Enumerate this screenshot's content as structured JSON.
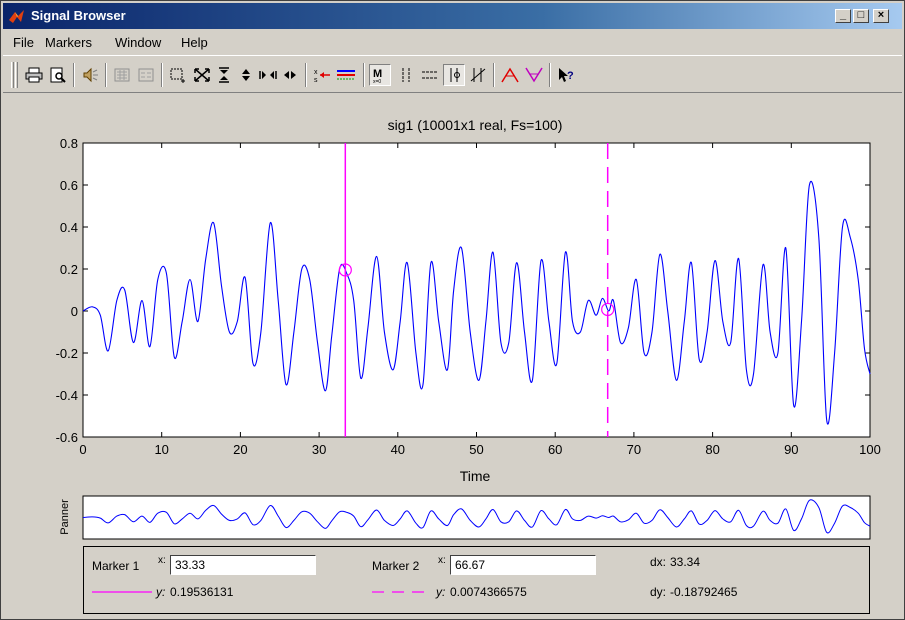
{
  "window": {
    "title": "Signal Browser"
  },
  "menu": [
    "File",
    "Markers",
    "Window",
    "Help"
  ],
  "toolbar": [
    "print",
    "print-preview",
    "play",
    "array-signal",
    "select-signals",
    "zoom-box",
    "zoom-full",
    "zoom-y-in",
    "zoom-y-out",
    "zoom-x-in",
    "zoom-x-out",
    "select-signal",
    "line-properties",
    "markers",
    "vertical-markers",
    "horizontal-markers",
    "track-markers",
    "slope-markers",
    "peaks",
    "valleys",
    "whats-this"
  ],
  "chart_data": {
    "type": "line",
    "title": "sig1 (10001x1 real, Fs=100)",
    "xlabel": "Time",
    "ylabel": "",
    "xlim": [
      0,
      100
    ],
    "ylim": [
      -0.6,
      0.8
    ],
    "xticks": [
      "0",
      "10",
      "20",
      "30",
      "40",
      "50",
      "60",
      "70",
      "80",
      "90",
      "100"
    ],
    "yticks": [
      "0.8",
      "0.6",
      "0.4",
      "0.2",
      "0",
      "-0.2",
      "-0.4",
      "-0.6"
    ],
    "series": [
      {
        "color": "#0000ff",
        "x": [
          0,
          1.2,
          2.2,
          3.2,
          4.3,
          5.3,
          6.4,
          7.5,
          8.5,
          9.5,
          10.6,
          11.6,
          12.6,
          13.6,
          14.6,
          15.6,
          16.6,
          17.6,
          18.6,
          19.6,
          20.6,
          21.6,
          22.6,
          23.8,
          24.8,
          25.8,
          26.8,
          27.8,
          28.8,
          29.8,
          30.8,
          31.6,
          32.6,
          33.5,
          34.4,
          35.3,
          36.2,
          37.3,
          38.3,
          39.4,
          40.3,
          41.2,
          42.3,
          43.2,
          44.2,
          45.2,
          46.3,
          47.1,
          48.1,
          49.2,
          50.3,
          51.2,
          52.1,
          53.1,
          54.1,
          55.1,
          56.1,
          57.1,
          58.2,
          59.2,
          60.2,
          61.3,
          62.2,
          63.2,
          64.2,
          65.2,
          66,
          66.8,
          67.4,
          68.3,
          69.3,
          70.3,
          71.3,
          72.3,
          73.3,
          74.3,
          75.4,
          76.4,
          77.3,
          78.3,
          79.3,
          80.3,
          81.3,
          82.3,
          83.3,
          84.3,
          85.2,
          86.4,
          87.3,
          88.3,
          89.3,
          90.3,
          91.3,
          92.3,
          93.5,
          94.5,
          95.5,
          96.5,
          97.5,
          98.5,
          99.3,
          100
        ],
        "y": [
          0,
          0.02,
          -0.02,
          -0.19,
          0.05,
          0.1,
          -0.15,
          0.05,
          -0.17,
          0.15,
          0.18,
          -0.22,
          -0.05,
          0.15,
          -0.05,
          0.25,
          0.42,
          0.12,
          -0.1,
          -0.05,
          0.16,
          -0.25,
          -0.1,
          0.42,
          0.05,
          -0.35,
          -0.1,
          0.2,
          0.15,
          -0.15,
          -0.38,
          -0.12,
          0.2,
          0.18,
          0.05,
          -0.32,
          -0.08,
          0.26,
          -0.1,
          -0.28,
          -0.05,
          0.23,
          -0.2,
          -0.35,
          0.23,
          -0.05,
          -0.28,
          0.1,
          0.3,
          -0.1,
          -0.33,
          -0.05,
          0.28,
          -0.15,
          -0.15,
          0.23,
          -0.1,
          -0.33,
          0.24,
          -0.05,
          -0.25,
          0.28,
          -0.05,
          -0.1,
          0.05,
          -0.02,
          0.06,
          0,
          0.05,
          -0.15,
          -0.08,
          0.15,
          -0.2,
          -0.1,
          0.27,
          0,
          -0.33,
          -0.05,
          0.23,
          -0.23,
          -0.1,
          0.24,
          -0.05,
          -0.15,
          0.25,
          -0.28,
          -0.3,
          0.22,
          -0.1,
          -0.2,
          0.3,
          -0.45,
          -0.05,
          0.6,
          0.35,
          -0.52,
          -0.2,
          0.4,
          0.35,
          0.15,
          -0.18,
          -0.3
        ]
      }
    ],
    "markers": [
      {
        "x": 33.33,
        "y": 0.19536131,
        "style": "solid",
        "color": "#ff00ff"
      },
      {
        "x": 66.67,
        "y": 0.0074366575,
        "style": "dashed",
        "color": "#ff00ff"
      }
    ]
  },
  "panner": {
    "label": "Panner"
  },
  "marker_panel": {
    "marker1": {
      "label": "Marker 1",
      "x_label": "x:",
      "x_value": "33.33",
      "y_label": "y:",
      "y_value": "0.19536131"
    },
    "marker2": {
      "label": "Marker 2",
      "x_label": "x:",
      "x_value": "66.67",
      "y_label": "y:",
      "y_value": "0.0074366575"
    },
    "dx_label": "dx:",
    "dx_value": "33.34",
    "dy_label": "dy:",
    "dy_value": "-0.18792465"
  }
}
